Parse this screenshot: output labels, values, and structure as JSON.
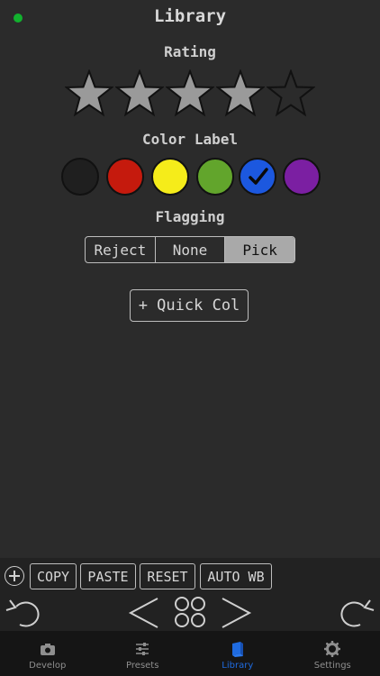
{
  "header": {
    "title": "Library",
    "status_color": "#12b12e"
  },
  "rating": {
    "label": "Rating",
    "value": 4,
    "max": 5
  },
  "color_label": {
    "label": "Color Label",
    "swatches": [
      {
        "name": "none",
        "color": "#1f1f1f",
        "selected": false
      },
      {
        "name": "red",
        "color": "#c51a0d",
        "selected": false
      },
      {
        "name": "yellow",
        "color": "#f5ec1a",
        "selected": false
      },
      {
        "name": "green",
        "color": "#62a52c",
        "selected": false
      },
      {
        "name": "blue",
        "color": "#1c58df",
        "selected": true
      },
      {
        "name": "purple",
        "color": "#7b1fa2",
        "selected": false
      }
    ]
  },
  "flagging": {
    "label": "Flagging",
    "options": [
      "Reject",
      "None",
      "Pick"
    ],
    "selected": "Pick"
  },
  "quick_collection": {
    "label": "+ Quick Col"
  },
  "toolbar": {
    "copy": "COPY",
    "paste": "PASTE",
    "reset": "RESET",
    "auto_wb": "AUTO WB"
  },
  "tabs": [
    {
      "label": "Develop",
      "icon": "camera-icon",
      "active": false
    },
    {
      "label": "Presets",
      "icon": "sliders-icon",
      "active": false
    },
    {
      "label": "Library",
      "icon": "book-icon",
      "active": true
    },
    {
      "label": "Settings",
      "icon": "gear-icon",
      "active": false
    }
  ],
  "colors": {
    "accent": "#1f6be0",
    "star_filled": "#9a9a9a"
  }
}
